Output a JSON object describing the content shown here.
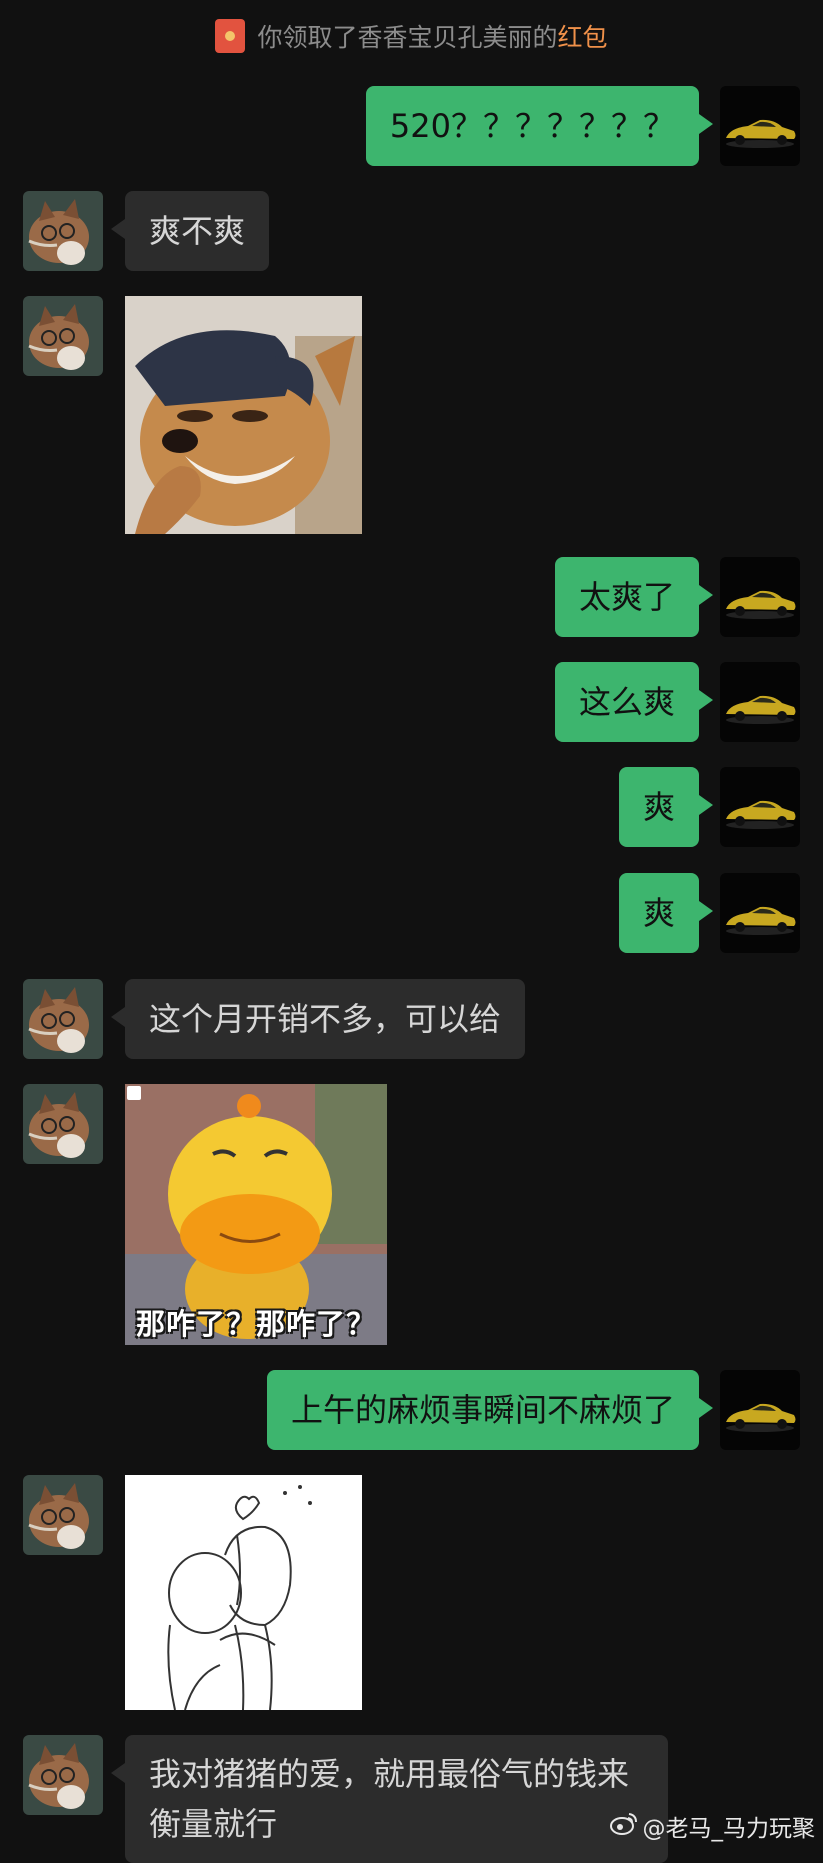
{
  "system_note": {
    "text": "你领取了香香宝贝孔美丽的",
    "link": "红包"
  },
  "messages": [
    {
      "side": "out",
      "text": "520？？？？？？？"
    },
    {
      "side": "in",
      "text": "爽不爽"
    },
    {
      "side": "in",
      "type": "sticker",
      "sticker": "dog-with-cap-grinning"
    },
    {
      "side": "out",
      "text": "太爽了"
    },
    {
      "side": "out",
      "text": "这么爽"
    },
    {
      "side": "out",
      "text": "爽"
    },
    {
      "side": "out",
      "text": "爽"
    },
    {
      "side": "in",
      "text": "这个月开销不多，可以给"
    },
    {
      "side": "in",
      "type": "sticker",
      "sticker": "yellow-duck",
      "caption": "那咋了？那咋了？"
    },
    {
      "side": "out",
      "text": "上午的麻烦事瞬间不麻烦了"
    },
    {
      "side": "in",
      "type": "sticker",
      "sticker": "hugging-couple-sketch"
    },
    {
      "side": "in",
      "text": "我对猪猪的爱，就用最俗气的钱来衡量就行"
    }
  ],
  "avatars": {
    "incoming": "cat-avatar",
    "outgoing": "yellow-sports-car-avatar"
  },
  "watermark": {
    "icon": "weibo-icon",
    "text": "@老马_马力玩聚"
  },
  "colors": {
    "background": "#111111",
    "outgoing_bubble": "#3db56e",
    "incoming_bubble": "#2c2c2c",
    "red_packet_link": "#f0914a"
  }
}
